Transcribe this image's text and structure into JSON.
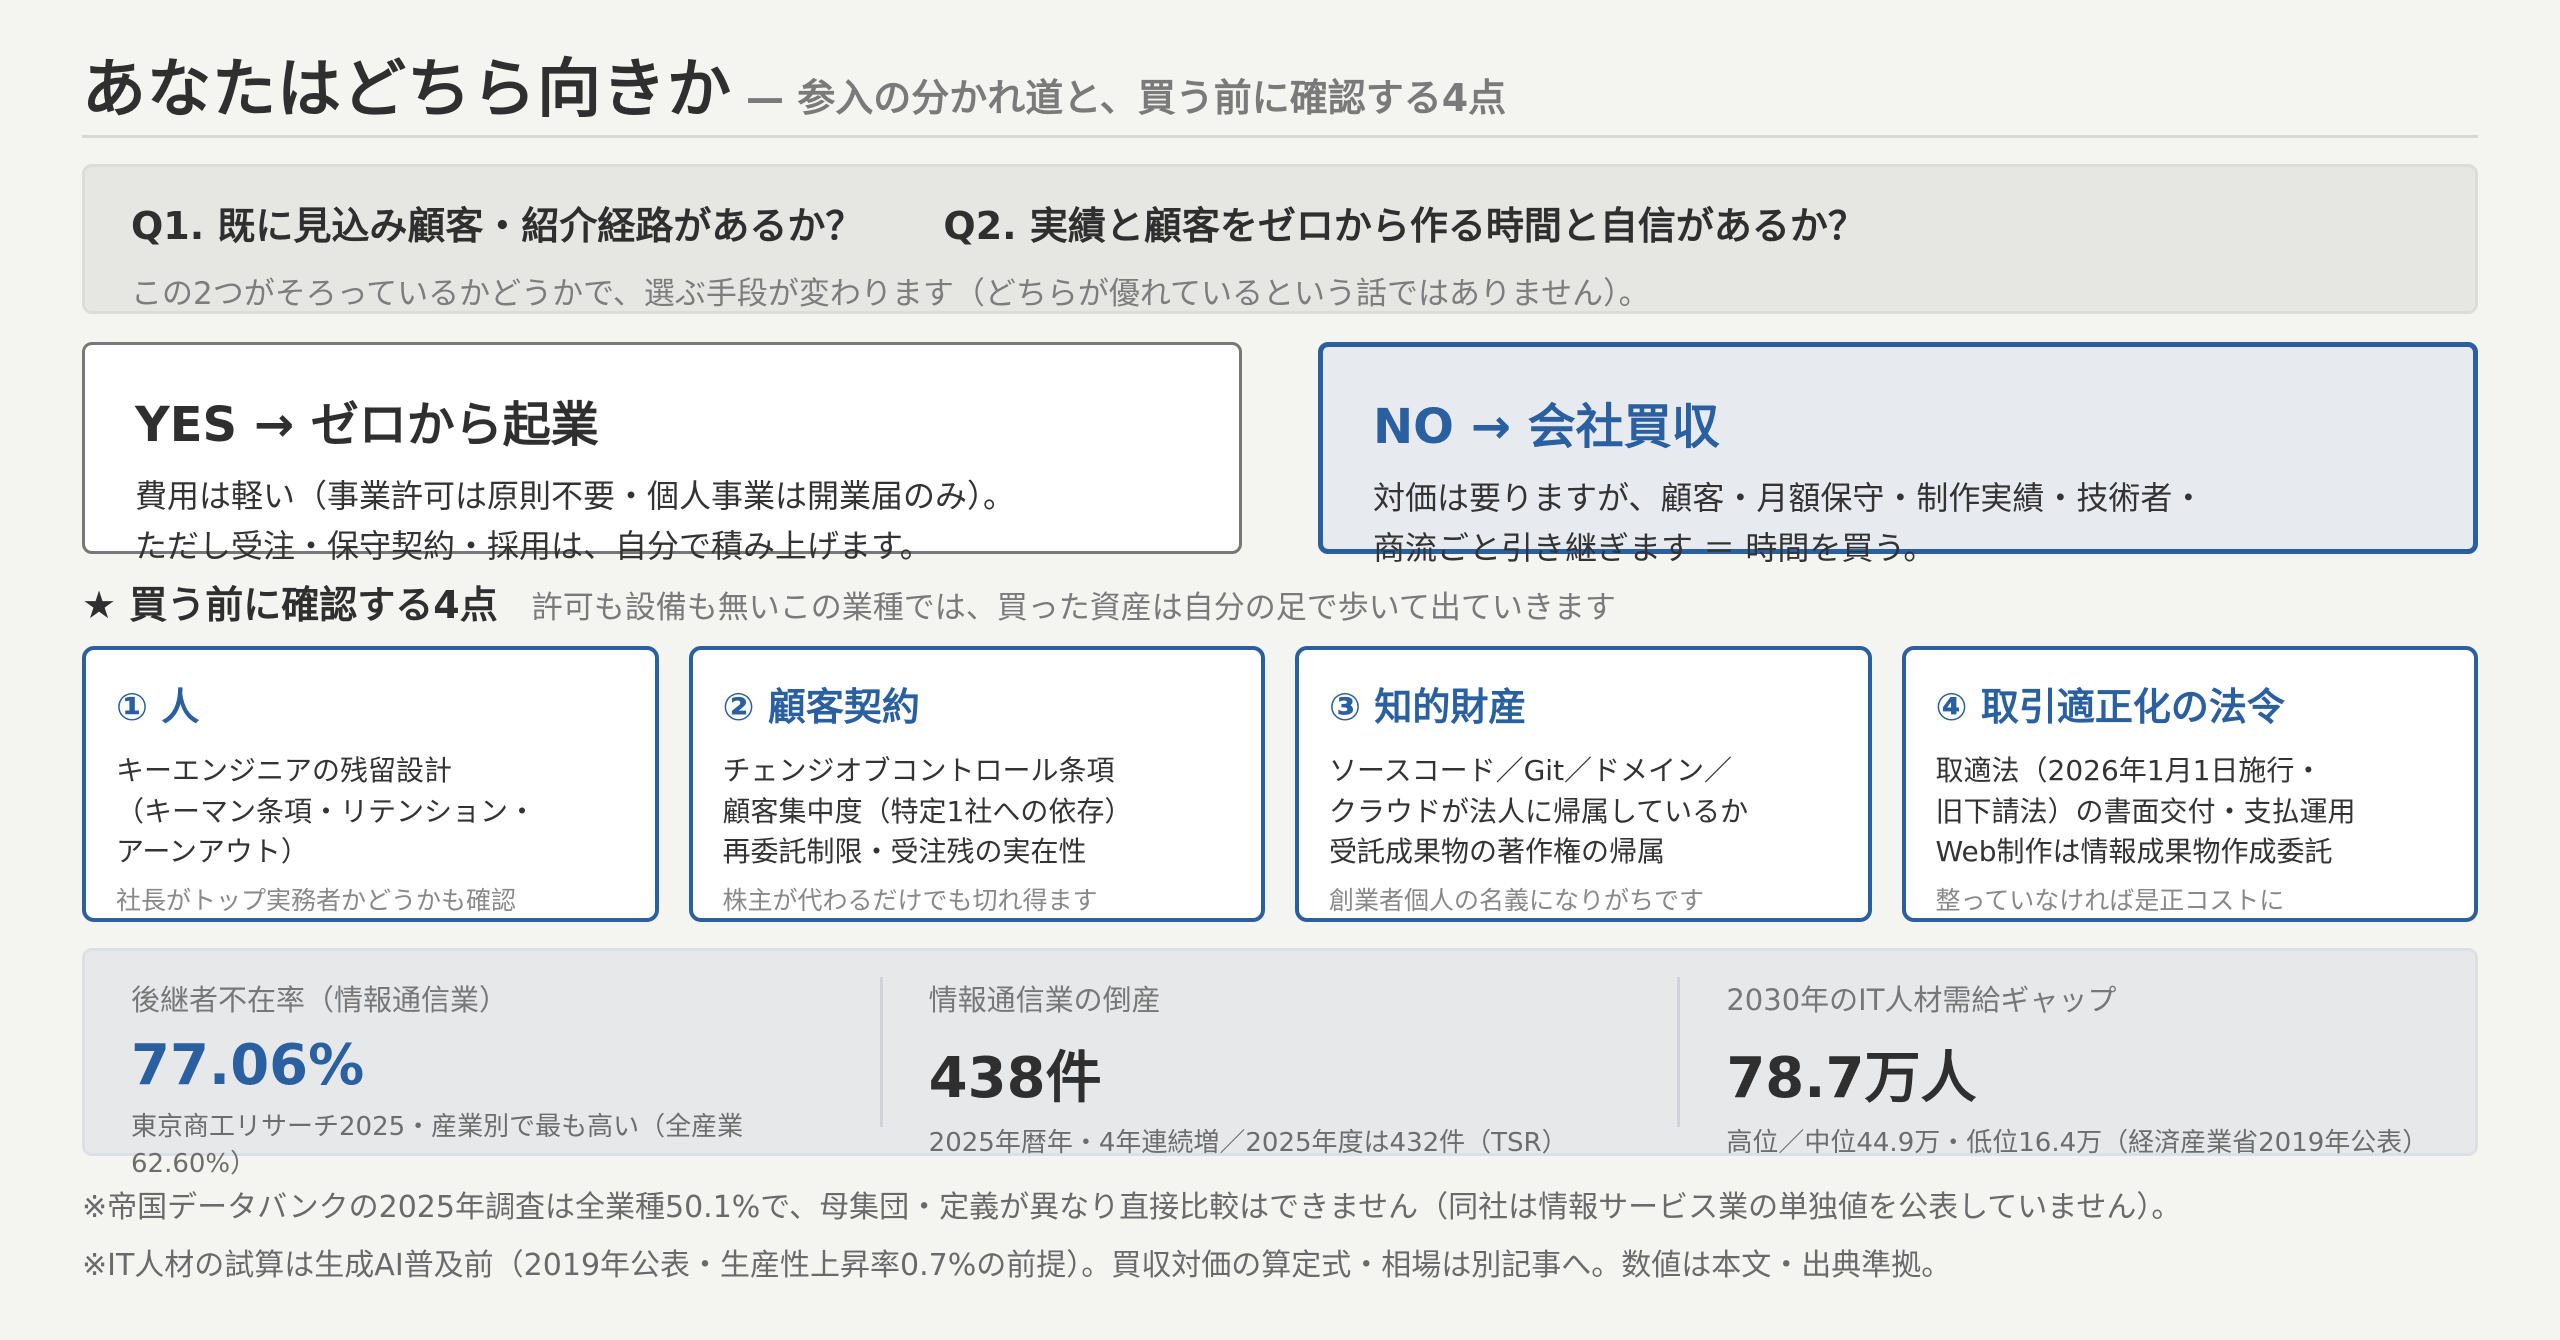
{
  "header": {
    "title": "あなたはどちら向きか",
    "subtitle": "— 参入の分かれ道と、買う前に確認する4点"
  },
  "questions": {
    "q1": "Q1. 既に見込み顧客・紹介経路があるか？",
    "q2": "Q2. 実績と顧客をゼロから作る時間と自信があるか？",
    "note": "この2つがそろっているかどうかで、選ぶ手段が変わります（どちらが優れているという話ではありません）。"
  },
  "choices": {
    "yes": {
      "title": "YES → ゼロから起業",
      "line1": "費用は軽い（事業許可は原則不要・個人事業は開業届のみ）。",
      "line2": "ただし受注・保守契約・採用は、自分で積み上げます。"
    },
    "no": {
      "title": "NO → 会社買収",
      "line1": "対価は要りますが、顧客・月額保守・制作実績・技術者・",
      "line2": "商流ごと引き継ぎます ＝ 時間を買う。"
    }
  },
  "section": {
    "title": "★ 買う前に確認する4点",
    "note": "許可も設備も無いこの業種では、買った資産は自分の足で歩いて出ていきます"
  },
  "cards": [
    {
      "title": "① 人",
      "lines": [
        "キーエンジニアの残留設計",
        "（キーマン条項・リテンション・",
        "アーンアウト）"
      ],
      "foot": "社長がトップ実務者かどうかも確認"
    },
    {
      "title": "② 顧客契約",
      "lines": [
        "チェンジオブコントロール条項",
        "顧客集中度（特定1社への依存）",
        "再委託制限・受注残の実在性"
      ],
      "foot": "株主が代わるだけでも切れ得ます"
    },
    {
      "title": "③ 知的財産",
      "lines": [
        "ソースコード／Git／ドメイン／",
        "クラウドが法人に帰属しているか",
        "受託成果物の著作権の帰属"
      ],
      "foot": "創業者個人の名義になりがちです"
    },
    {
      "title": "④ 取引適正化の法令",
      "lines": [
        "取適法（2026年1月1日施行・",
        "旧下請法）の書面交付・支払運用",
        "Web制作は情報成果物作成委託"
      ],
      "foot": "整っていなければ是正コストに"
    }
  ],
  "stats": [
    {
      "label": "後継者不在率（情報通信業）",
      "value": "77.06%",
      "note": "東京商工リサーチ2025・産業別で最も高い（全産業62.60%）"
    },
    {
      "label": "情報通信業の倒産",
      "value": "438件",
      "note": "2025年暦年・4年連続増／2025年度は432件（TSR）"
    },
    {
      "label": "2030年のIT人材需給ギャップ",
      "value": "78.7万人",
      "note": "高位／中位44.9万・低位16.4万（経済産業省2019年公表）"
    }
  ],
  "footnotes": {
    "f1": "※帝国データバンクの2025年調査は全業種50.1%で、母集団・定義が異なり直接比較はできません（同社は情報サービス業の単独値を公表していません）。",
    "f2": "※IT人材の試算は生成AI普及前（2019年公表・生産性上昇率0.7%の前提）。買収対価の算定式・相場は別記事へ。数値は本文・出典準拠。"
  }
}
